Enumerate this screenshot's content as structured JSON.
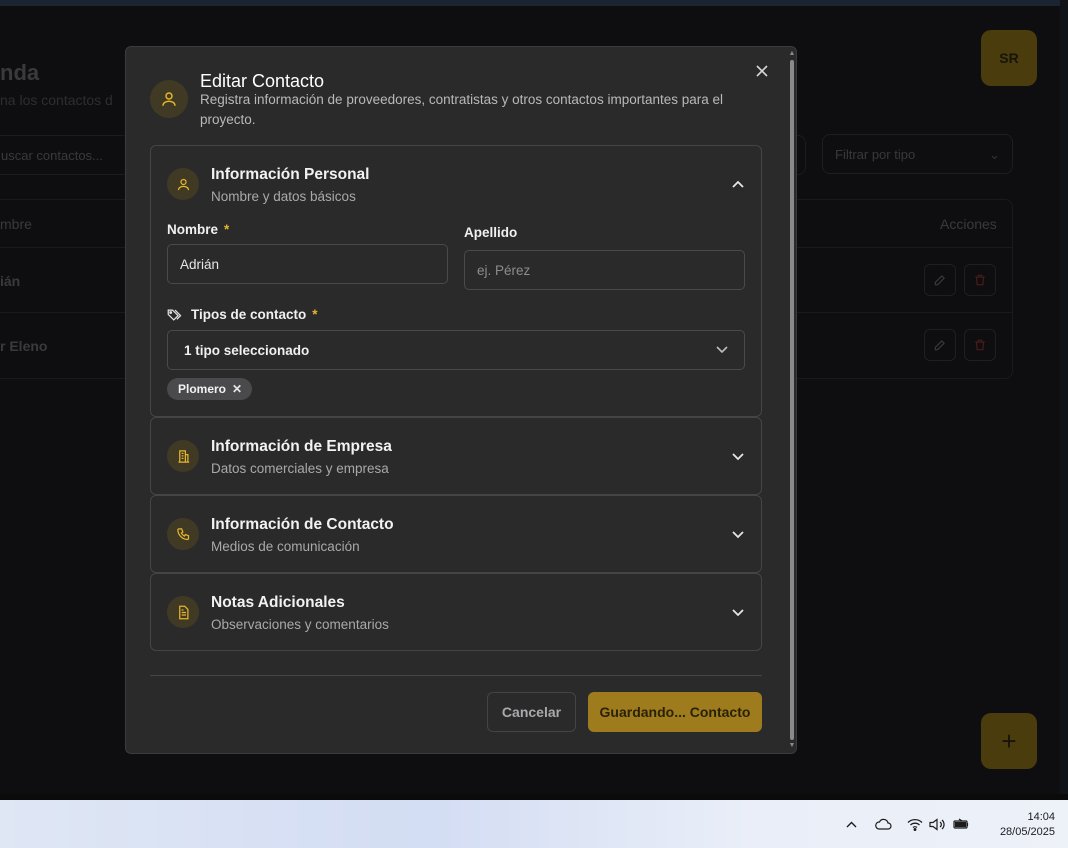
{
  "background": {
    "page_title": "nda",
    "page_subtitle": "na los contactos d",
    "avatar_initials": "SR",
    "search_placeholder": "uscar contactos...",
    "filter_placeholder": "Filtrar por tipo",
    "table_headers": {
      "name": "mbre",
      "actions": "Acciones"
    },
    "rows": [
      {
        "name": "ián"
      },
      {
        "name": "r Eleno"
      }
    ],
    "fab_label": "+"
  },
  "modal": {
    "title": "Editar Contacto",
    "description": "Registra información de proveedores, contratistas y otros contactos importantes para el proyecto.",
    "sections": {
      "personal": {
        "title": "Información Personal",
        "subtitle": "Nombre y datos básicos",
        "icon": "user-icon",
        "expanded": true,
        "first_name_label": "Nombre",
        "first_name_value": "Adrián",
        "last_name_label": "Apellido",
        "last_name_placeholder": "ej. Pérez",
        "types_label": "Tipos de contacto",
        "required_mark": "*",
        "types_select_value": "1 tipo seleccionado",
        "selected_types": [
          "Plomero"
        ]
      },
      "company": {
        "title": "Información de Empresa",
        "subtitle": "Datos comerciales y empresa",
        "icon": "building-icon",
        "expanded": false
      },
      "contact": {
        "title": "Información de Contacto",
        "subtitle": "Medios de comunicación",
        "icon": "phone-icon",
        "expanded": false
      },
      "notes": {
        "title": "Notas Adicionales",
        "subtitle": "Observaciones y comentarios",
        "icon": "document-icon",
        "expanded": false
      }
    },
    "buttons": {
      "cancel": "Cancelar",
      "save": "Guardando... Contacto"
    }
  },
  "taskbar": {
    "time": "14:04",
    "date": "28/05/2025"
  },
  "colors": {
    "accent": "#e5b52c",
    "save_button": "#9e7b1c",
    "modal_bg": "#2a2a2b",
    "backdrop": "#0e0e10"
  }
}
